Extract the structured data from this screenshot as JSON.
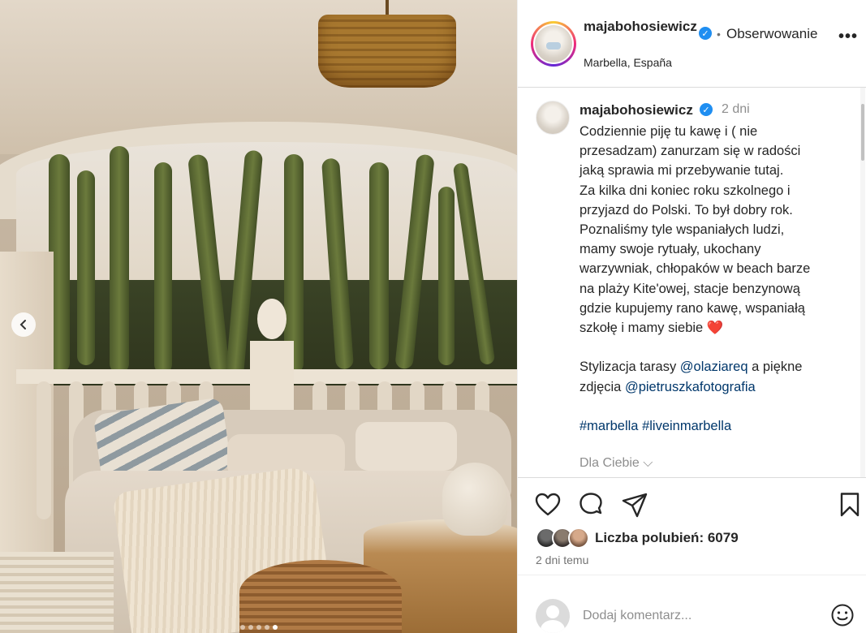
{
  "post": {
    "username": "majabohosiewicz",
    "location": "Marbella, España",
    "follow_label": "Obserwowanie",
    "separator": "•",
    "more_label": "•••",
    "verified_glyph": "✓"
  },
  "caption": {
    "username": "majabohosiewicz",
    "time": "2 dni",
    "lines": [
      "Codziennie piję tu kawę i ( nie",
      "przesadzam) zanurzam się w radości",
      "jaką sprawia mi przebywanie tutaj.",
      "Za kilka dni koniec roku szkolnego i",
      "przyjazd do Polski. To był dobry rok.",
      "Poznaliśmy tyle wspaniałych ludzi,",
      "mamy swoje rytuały, ukochany",
      "warzywniak, chłopaków w beach barze",
      "na plaży Kite'owej, stacje benzynową",
      "gdzie kupujemy rano kawę, wspaniałą",
      "szkołę i mamy siebie"
    ],
    "heart_emoji": "❤️",
    "styling_prefix": "Stylizacja tarasy ",
    "styling_mention": "@olaziareq",
    "styling_suffix": " a piękne",
    "photos_prefix": "zdjęcia ",
    "photos_mention": "@pietruszkafotografia",
    "hashtag_1": "#marbella",
    "hashtag_2": "#liveinmarbella",
    "for_you": "Dla Ciebie",
    "for_you_chevron": "⌵"
  },
  "actions": {
    "icons": [
      "heart-icon",
      "comment-icon",
      "share-icon",
      "bookmark-icon"
    ],
    "likes": "Liczba polubień: 6079",
    "ago": "2 dni temu"
  },
  "comment": {
    "placeholder": "Dodaj komentarz..."
  },
  "carousel": {
    "prev_glyph": "‹",
    "total": 5,
    "active_index": 4
  },
  "colors": {
    "verified": "#1f8ef1",
    "link": "#00376b",
    "heart": "#e0245e"
  }
}
